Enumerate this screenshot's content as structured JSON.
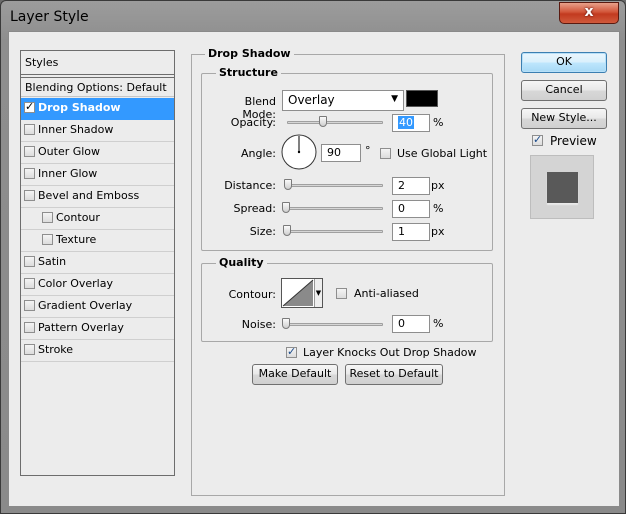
{
  "window": {
    "title": "Layer Style",
    "close_glyph": "x"
  },
  "styles_panel": {
    "header": "Styles",
    "blending_options": "Blending Options: Default",
    "items": [
      {
        "label": "Drop Shadow",
        "checked": true,
        "selected": true,
        "indent": false
      },
      {
        "label": "Inner Shadow",
        "checked": false,
        "selected": false,
        "indent": false
      },
      {
        "label": "Outer Glow",
        "checked": false,
        "selected": false,
        "indent": false
      },
      {
        "label": "Inner Glow",
        "checked": false,
        "selected": false,
        "indent": false
      },
      {
        "label": "Bevel and Emboss",
        "checked": false,
        "selected": false,
        "indent": false
      },
      {
        "label": "Contour",
        "checked": false,
        "selected": false,
        "indent": true
      },
      {
        "label": "Texture",
        "checked": false,
        "selected": false,
        "indent": true
      },
      {
        "label": "Satin",
        "checked": false,
        "selected": false,
        "indent": false
      },
      {
        "label": "Color Overlay",
        "checked": false,
        "selected": false,
        "indent": false
      },
      {
        "label": "Gradient Overlay",
        "checked": false,
        "selected": false,
        "indent": false
      },
      {
        "label": "Pattern Overlay",
        "checked": false,
        "selected": false,
        "indent": false
      },
      {
        "label": "Stroke",
        "checked": false,
        "selected": false,
        "indent": false
      }
    ]
  },
  "drop_shadow": {
    "title": "Drop Shadow",
    "structure": {
      "title": "Structure",
      "blend_mode_label": "Blend Mode:",
      "blend_mode_value": "Overlay",
      "shadow_color": "#000000",
      "opacity_label": "Opacity:",
      "opacity_value": "40",
      "opacity_unit": "%",
      "angle_label": "Angle:",
      "angle_value": "90",
      "angle_unit": "°",
      "use_global_light_label": "Use Global Light",
      "use_global_light_checked": false,
      "distance_label": "Distance:",
      "distance_value": "2",
      "distance_unit": "px",
      "spread_label": "Spread:",
      "spread_value": "0",
      "spread_unit": "%",
      "size_label": "Size:",
      "size_value": "1",
      "size_unit": "px"
    },
    "quality": {
      "title": "Quality",
      "contour_label": "Contour:",
      "anti_aliased_label": "Anti-aliased",
      "anti_aliased_checked": false,
      "noise_label": "Noise:",
      "noise_value": "0",
      "noise_unit": "%"
    },
    "knockout_label": "Layer Knocks Out Drop Shadow",
    "knockout_checked": true,
    "make_default_label": "Make Default",
    "reset_default_label": "Reset to Default"
  },
  "buttons": {
    "ok": "OK",
    "cancel": "Cancel",
    "new_style": "New Style...",
    "preview_label": "Preview",
    "preview_checked": true
  },
  "colors": {
    "selection": "#3399ff",
    "shadow_swatch": "#000000",
    "preview_square": "#595959"
  }
}
